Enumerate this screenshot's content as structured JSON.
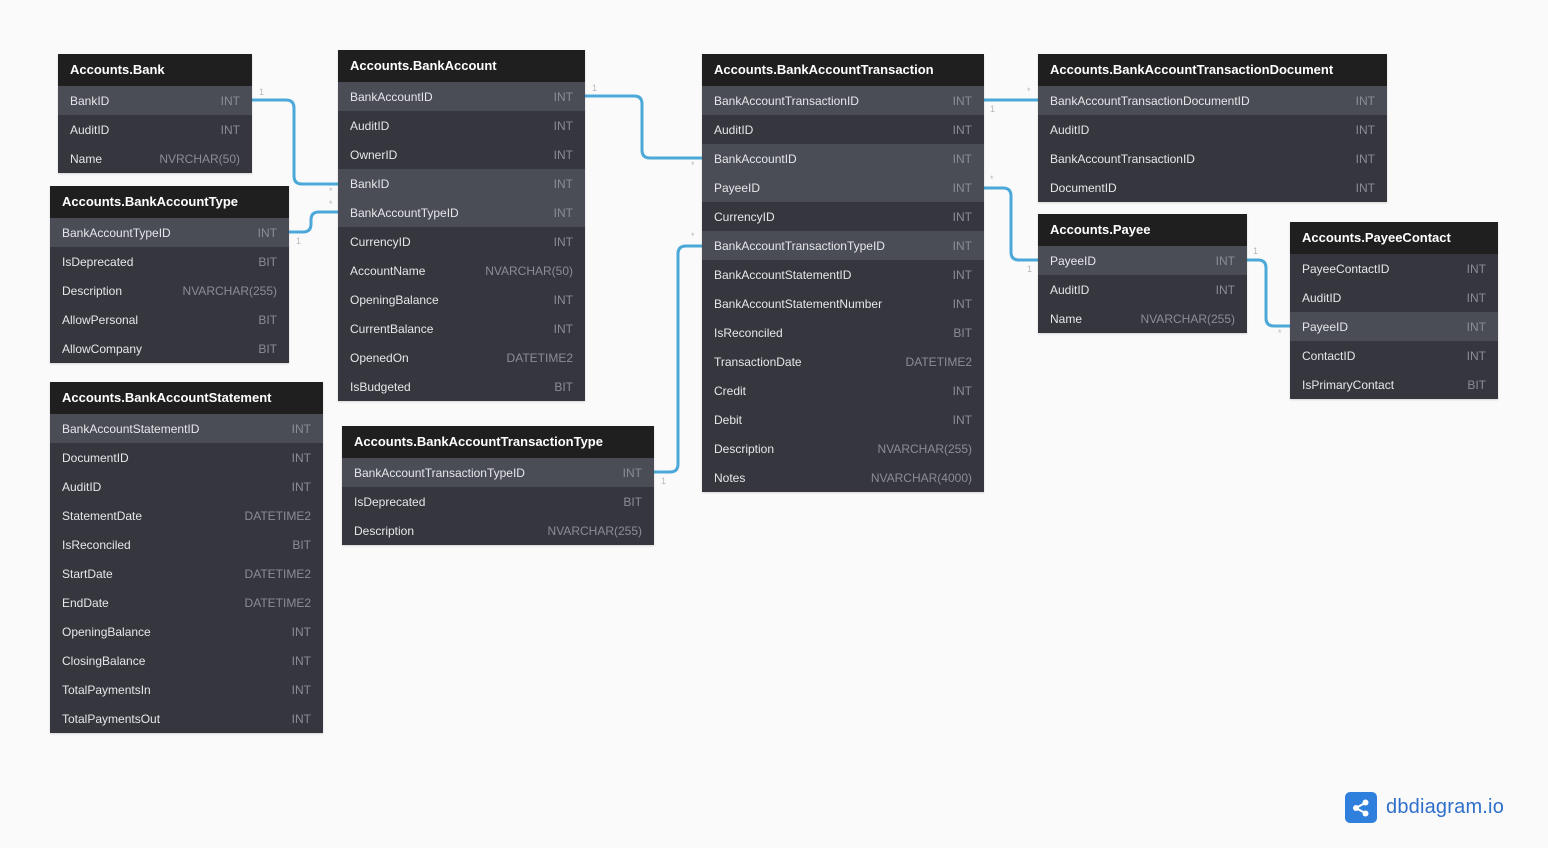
{
  "colors": {
    "accent": "#4ba8d8",
    "header": "#1f1f1f",
    "body": "#35363e",
    "highlight": "#4a4c56",
    "brand": "#2f7fdc"
  },
  "tables": [
    {
      "id": "bank",
      "title": "Accounts.Bank",
      "fields": [
        {
          "name": "BankID",
          "type": "INT",
          "hl": true
        },
        {
          "name": "AuditID",
          "type": "INT"
        },
        {
          "name": "Name",
          "type": "NVRCHAR(50)"
        }
      ]
    },
    {
      "id": "bankaccounttype",
      "title": "Accounts.BankAccountType",
      "fields": [
        {
          "name": "BankAccountTypeID",
          "type": "INT",
          "hl": true
        },
        {
          "name": "IsDeprecated",
          "type": "BIT"
        },
        {
          "name": "Description",
          "type": "NVARCHAR(255)"
        },
        {
          "name": "AllowPersonal",
          "type": "BIT"
        },
        {
          "name": "AllowCompany",
          "type": "BIT"
        }
      ]
    },
    {
      "id": "bankaccountstatement",
      "title": "Accounts.BankAccountStatement",
      "fields": [
        {
          "name": "BankAccountStatementID",
          "type": "INT",
          "hl": true
        },
        {
          "name": "DocumentID",
          "type": "INT"
        },
        {
          "name": "AuditID",
          "type": "INT"
        },
        {
          "name": "StatementDate",
          "type": "DATETIME2"
        },
        {
          "name": "IsReconciled",
          "type": "BIT"
        },
        {
          "name": "StartDate",
          "type": "DATETIME2"
        },
        {
          "name": "EndDate",
          "type": "DATETIME2"
        },
        {
          "name": "OpeningBalance",
          "type": "INT"
        },
        {
          "name": "ClosingBalance",
          "type": "INT"
        },
        {
          "name": "TotalPaymentsIn",
          "type": "INT"
        },
        {
          "name": "TotalPaymentsOut",
          "type": "INT"
        }
      ]
    },
    {
      "id": "bankaccount",
      "title": "Accounts.BankAccount",
      "fields": [
        {
          "name": "BankAccountID",
          "type": "INT",
          "hl": true
        },
        {
          "name": "AuditID",
          "type": "INT"
        },
        {
          "name": "OwnerID",
          "type": "INT"
        },
        {
          "name": "BankID",
          "type": "INT",
          "hl": true
        },
        {
          "name": "BankAccountTypeID",
          "type": "INT",
          "hl": true
        },
        {
          "name": "CurrencyID",
          "type": "INT"
        },
        {
          "name": "AccountName",
          "type": "NVARCHAR(50)"
        },
        {
          "name": "OpeningBalance",
          "type": "INT"
        },
        {
          "name": "CurrentBalance",
          "type": "INT"
        },
        {
          "name": "OpenedOn",
          "type": "DATETIME2"
        },
        {
          "name": "IsBudgeted",
          "type": "BIT"
        }
      ]
    },
    {
      "id": "bankaccounttransactiontype",
      "title": "Accounts.BankAccountTransactionType",
      "fields": [
        {
          "name": "BankAccountTransactionTypeID",
          "type": "INT",
          "hl": true
        },
        {
          "name": "IsDeprecated",
          "type": "BIT"
        },
        {
          "name": "Description",
          "type": "NVARCHAR(255)"
        }
      ]
    },
    {
      "id": "bankaccounttransaction",
      "title": "Accounts.BankAccountTransaction",
      "fields": [
        {
          "name": "BankAccountTransactionID",
          "type": "INT",
          "hl": true
        },
        {
          "name": "AuditID",
          "type": "INT"
        },
        {
          "name": "BankAccountID",
          "type": "INT",
          "hl": true
        },
        {
          "name": "PayeeID",
          "type": "INT",
          "hl": true
        },
        {
          "name": "CurrencyID",
          "type": "INT"
        },
        {
          "name": "BankAccountTransactionTypeID",
          "type": "INT",
          "hl": true
        },
        {
          "name": "BankAccountStatementID",
          "type": "INT"
        },
        {
          "name": "BankAccountStatementNumber",
          "type": "INT"
        },
        {
          "name": "IsReconciled",
          "type": "BIT"
        },
        {
          "name": "TransactionDate",
          "type": "DATETIME2"
        },
        {
          "name": "Credit",
          "type": "INT"
        },
        {
          "name": "Debit",
          "type": "INT"
        },
        {
          "name": "Description",
          "type": "NVARCHAR(255)"
        },
        {
          "name": "Notes",
          "type": "NVARCHAR(4000)"
        }
      ]
    },
    {
      "id": "bankaccounttransactiondocument",
      "title": "Accounts.BankAccountTransactionDocument",
      "fields": [
        {
          "name": "BankAccountTransactionDocumentID",
          "type": "INT",
          "hl": true
        },
        {
          "name": "AuditID",
          "type": "INT"
        },
        {
          "name": "BankAccountTransactionID",
          "type": "INT"
        },
        {
          "name": "DocumentID",
          "type": "INT"
        }
      ]
    },
    {
      "id": "payee",
      "title": "Accounts.Payee",
      "fields": [
        {
          "name": "PayeeID",
          "type": "INT",
          "hl": true
        },
        {
          "name": "AuditID",
          "type": "INT"
        },
        {
          "name": "Name",
          "type": "NVARCHAR(255)"
        }
      ]
    },
    {
      "id": "payeecontact",
      "title": "Accounts.PayeeContact",
      "fields": [
        {
          "name": "PayeeContactID",
          "type": "INT"
        },
        {
          "name": "AuditID",
          "type": "INT"
        },
        {
          "name": "PayeeID",
          "type": "INT",
          "hl": true
        },
        {
          "name": "ContactID",
          "type": "INT"
        },
        {
          "name": "IsPrimaryContact",
          "type": "BIT"
        }
      ]
    }
  ],
  "relationships": [
    {
      "from": "Accounts.Bank.BankID",
      "to": "Accounts.BankAccount.BankID",
      "from_card": "1",
      "to_card": "*"
    },
    {
      "from": "Accounts.BankAccountType.BankAccountTypeID",
      "to": "Accounts.BankAccount.BankAccountTypeID",
      "from_card": "1",
      "to_card": "*"
    },
    {
      "from": "Accounts.BankAccount.BankAccountID",
      "to": "Accounts.BankAccountTransaction.BankAccountID",
      "from_card": "1",
      "to_card": "*"
    },
    {
      "from": "Accounts.BankAccountTransactionType.BankAccountTransactionTypeID",
      "to": "Accounts.BankAccountTransaction.BankAccountTransactionTypeID",
      "from_card": "1",
      "to_card": "*"
    },
    {
      "from": "Accounts.BankAccountTransaction.BankAccountTransactionID",
      "to": "Accounts.BankAccountTransactionDocument.BankAccountTransactionDocumentID",
      "from_card": "1",
      "to_card": "*"
    },
    {
      "from": "Accounts.Payee.PayeeID",
      "to": "Accounts.BankAccountTransaction.PayeeID",
      "from_card": "1",
      "to_card": "*"
    },
    {
      "from": "Accounts.Payee.PayeeID",
      "to": "Accounts.PayeeContact.PayeeID",
      "from_card": "1",
      "to_card": "*"
    }
  ],
  "brand": {
    "name": "dbdiagram.io",
    "icon": "share-nodes-icon"
  }
}
